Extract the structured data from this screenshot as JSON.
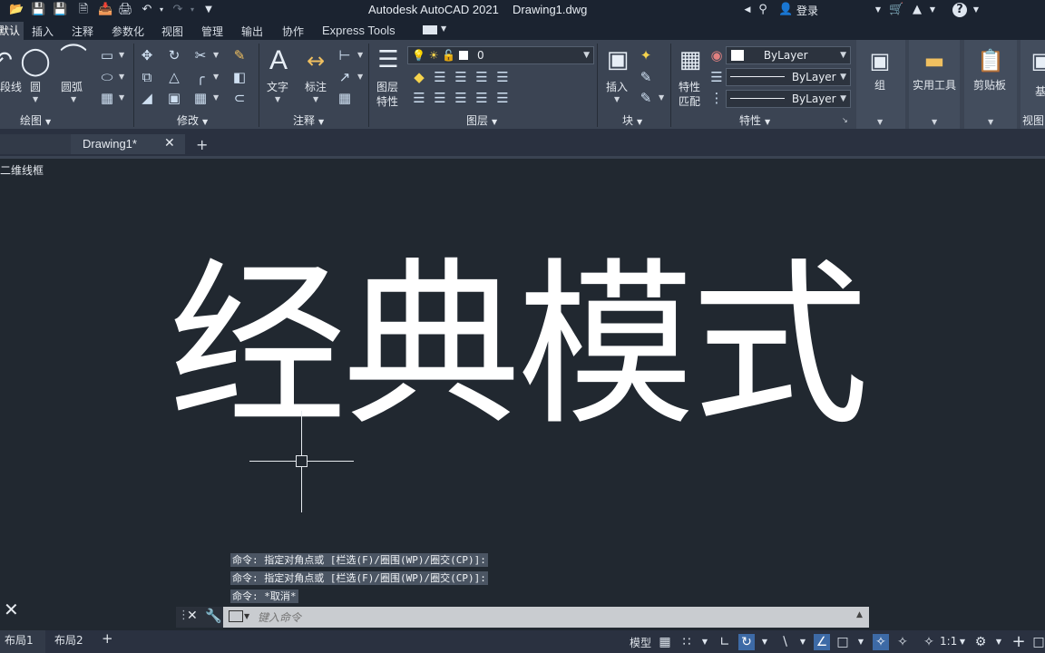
{
  "window": {
    "app_title": "Autodesk AutoCAD 2021",
    "file_name": "Drawing1.dwg",
    "sign_in": "登录"
  },
  "ribbon_tabs": [
    "默认",
    "插入",
    "注释",
    "参数化",
    "视图",
    "管理",
    "输出",
    "协作",
    "Express Tools"
  ],
  "draw_panel": {
    "polyline": "多段线",
    "circle": "圆",
    "arc": "圆弧",
    "label": "绘图"
  },
  "modify_panel": {
    "label": "修改"
  },
  "annotation_panel": {
    "text": "文字",
    "dimension": "标注",
    "label": "注释"
  },
  "layers_panel": {
    "layer_props_line1": "图层",
    "layer_props_line2": "特性",
    "current_layer": "0",
    "label": "图层"
  },
  "block_panel": {
    "insert": "插入",
    "label": "块"
  },
  "properties_panel": {
    "match_line1": "特性",
    "match_line2": "匹配",
    "color": "ByLayer",
    "linetype": "ByLayer",
    "lineweight": "ByLayer",
    "label": "特性"
  },
  "group_panel": {
    "label": "组"
  },
  "utilities_panel": {
    "label": "实用工具"
  },
  "clipboard_panel": {
    "label": "剪贴板"
  },
  "view_panel": {
    "base": "基",
    "label": "视图"
  },
  "doc_tab": {
    "name": "Drawing1*"
  },
  "viewport": {
    "visual_style": "[-][俯视][二维线框]",
    "visual_style_visible": "二维线框"
  },
  "drawing": {
    "text": "经典模式"
  },
  "command_history": [
    "命令: 指定对角点或 [栏选(F)/圈围(WP)/圈交(CP)]:",
    "命令: 指定对角点或 [栏选(F)/圈围(WP)/圈交(CP)]:",
    "命令: *取消*"
  ],
  "command_input": {
    "placeholder": "键入命令"
  },
  "layout_tabs": [
    "布局1",
    "布局2"
  ],
  "status": {
    "model": "模型",
    "scale": "1:1"
  },
  "colors": {
    "canvas": "#212830",
    "ribbon": "#3b4453",
    "accent": "#3d6aa6"
  }
}
